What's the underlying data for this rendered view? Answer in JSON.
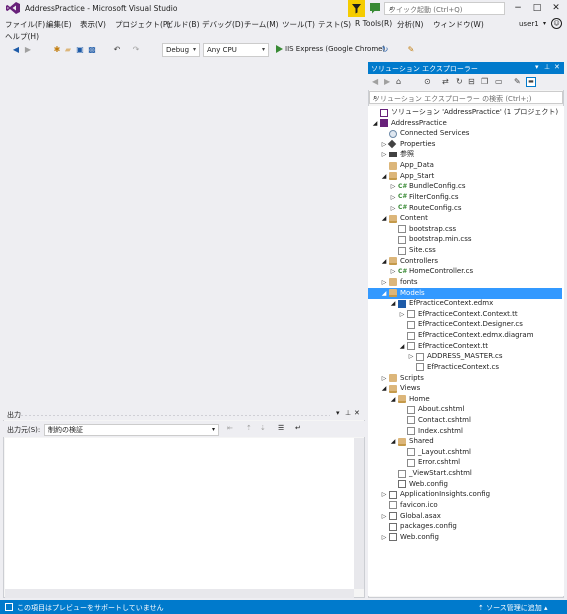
{
  "window": {
    "title": "AddressPractice - Microsoft Visual Studio",
    "quick_launch_placeholder": "クイック起動 (Ctrl+Q)",
    "user": "user1",
    "minimize": "−",
    "maximize": "□",
    "close": "✕"
  },
  "menu": {
    "items": [
      "ファイル(F)",
      "編集(E)",
      "表示(V)",
      "プロジェクト(P)",
      "ビルド(B)",
      "デバッグ(D)",
      "チーム(M)",
      "ツール(T)",
      "テスト(S)",
      "R Tools(R)",
      "分析(N)",
      "ウィンドウ(W)",
      "ヘルプ(H)"
    ]
  },
  "toolbar": {
    "config": "Debug",
    "platform": "Any CPU",
    "run_target": "IIS Express (Google Chrome)"
  },
  "output": {
    "title": "出力",
    "source_label": "出力元(S):",
    "source_value": "制約の検証"
  },
  "solution_explorer": {
    "title": "ソリューション エクスプローラー",
    "search_placeholder": "ソリューション エクスプローラー の検索 (Ctrl+;)",
    "tree": [
      {
        "label": "ソリューション 'AddressPractice' (1 プロジェクト)",
        "icon": "solution-icon"
      },
      {
        "label": "AddressPractice",
        "icon": "project-icon"
      },
      {
        "label": "Connected Services",
        "icon": "cloud-icon"
      },
      {
        "label": "Properties",
        "icon": "properties-icon"
      },
      {
        "label": "参照",
        "icon": "references-icon"
      },
      {
        "label": "App_Data",
        "icon": "folder-icon"
      },
      {
        "label": "App_Start",
        "icon": "folder-icon"
      },
      {
        "label": "BundleConfig.cs",
        "icon": "csharp-icon"
      },
      {
        "label": "FilterConfig.cs",
        "icon": "csharp-icon"
      },
      {
        "label": "RouteConfig.cs",
        "icon": "csharp-icon"
      },
      {
        "label": "Content",
        "icon": "folder-icon"
      },
      {
        "label": "bootstrap.css",
        "icon": "css-file-icon"
      },
      {
        "label": "bootstrap.min.css",
        "icon": "css-file-icon"
      },
      {
        "label": "Site.css",
        "icon": "css-file-icon"
      },
      {
        "label": "Controllers",
        "icon": "folder-icon"
      },
      {
        "label": "HomeController.cs",
        "icon": "csharp-icon"
      },
      {
        "label": "fonts",
        "icon": "folder-icon"
      },
      {
        "label": "Models",
        "icon": "folder-icon"
      },
      {
        "label": "EfPracticeContext.edmx",
        "icon": "edmx-icon"
      },
      {
        "label": "EfPracticeContext.Context.tt",
        "icon": "tt-file-icon"
      },
      {
        "label": "EfPracticeContext.Designer.cs",
        "icon": "file-icon"
      },
      {
        "label": "EfPracticeContext.edmx.diagram",
        "icon": "file-icon"
      },
      {
        "label": "EfPracticeContext.tt",
        "icon": "tt-file-icon"
      },
      {
        "label": "ADDRESS_MASTER.cs",
        "icon": "file-icon"
      },
      {
        "label": "EfPracticeContext.cs",
        "icon": "file-icon"
      },
      {
        "label": "Scripts",
        "icon": "folder-icon"
      },
      {
        "label": "Views",
        "icon": "folder-icon"
      },
      {
        "label": "Home",
        "icon": "folder-icon"
      },
      {
        "label": "About.cshtml",
        "icon": "cshtml-icon"
      },
      {
        "label": "Contact.cshtml",
        "icon": "cshtml-icon"
      },
      {
        "label": "Index.cshtml",
        "icon": "cshtml-icon"
      },
      {
        "label": "Shared",
        "icon": "folder-icon"
      },
      {
        "label": "_Layout.cshtml",
        "icon": "cshtml-icon"
      },
      {
        "label": "Error.cshtml",
        "icon": "cshtml-icon"
      },
      {
        "label": "_ViewStart.cshtml",
        "icon": "cshtml-icon"
      },
      {
        "label": "Web.config",
        "icon": "config-icon"
      },
      {
        "label": "ApplicationInsights.config",
        "icon": "config-icon"
      },
      {
        "label": "favicon.ico",
        "icon": "file-icon"
      },
      {
        "label": "Global.asax",
        "icon": "config-icon"
      },
      {
        "label": "packages.config",
        "icon": "config-icon"
      },
      {
        "label": "Web.config",
        "icon": "config-icon"
      }
    ]
  },
  "statusbar": {
    "message": "この項目はプレビューをサポートしていません",
    "source_control": "ソース管理に追加"
  }
}
